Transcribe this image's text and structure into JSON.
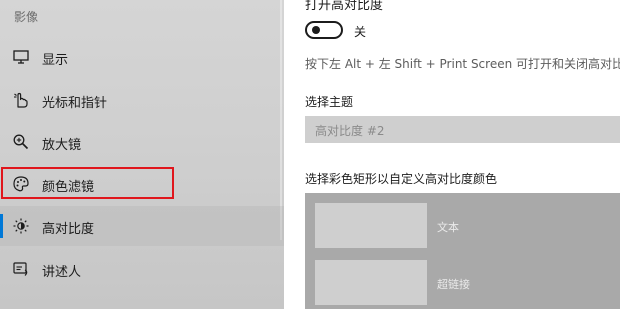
{
  "sidebar": {
    "section_title": "影像",
    "items": [
      {
        "label": "显示",
        "icon": "monitor-icon"
      },
      {
        "label": "光标和指针",
        "icon": "pointer-hand-icon"
      },
      {
        "label": "放大镜",
        "icon": "magnifier-icon"
      },
      {
        "label": "颜色滤镜",
        "icon": "palette-icon"
      },
      {
        "label": "高对比度",
        "icon": "brightness-icon"
      },
      {
        "label": "讲述人",
        "icon": "narrator-icon"
      }
    ],
    "selected_item": "高对比度",
    "accent_color": "#0078d7",
    "highlight_color": "#e0161c"
  },
  "content": {
    "title": "打开高对比度",
    "toggle_state": "关",
    "shortcut_hint": "按下左 Alt + 左 Shift + Print Screen 可打开和关闭高对比度",
    "theme_label": "选择主题",
    "theme_value": "高对比度 #2",
    "color_section_label": "选择彩色矩形以自定义高对比度颜色",
    "swatches": [
      {
        "label": "文本"
      },
      {
        "label": "超链接"
      }
    ]
  }
}
